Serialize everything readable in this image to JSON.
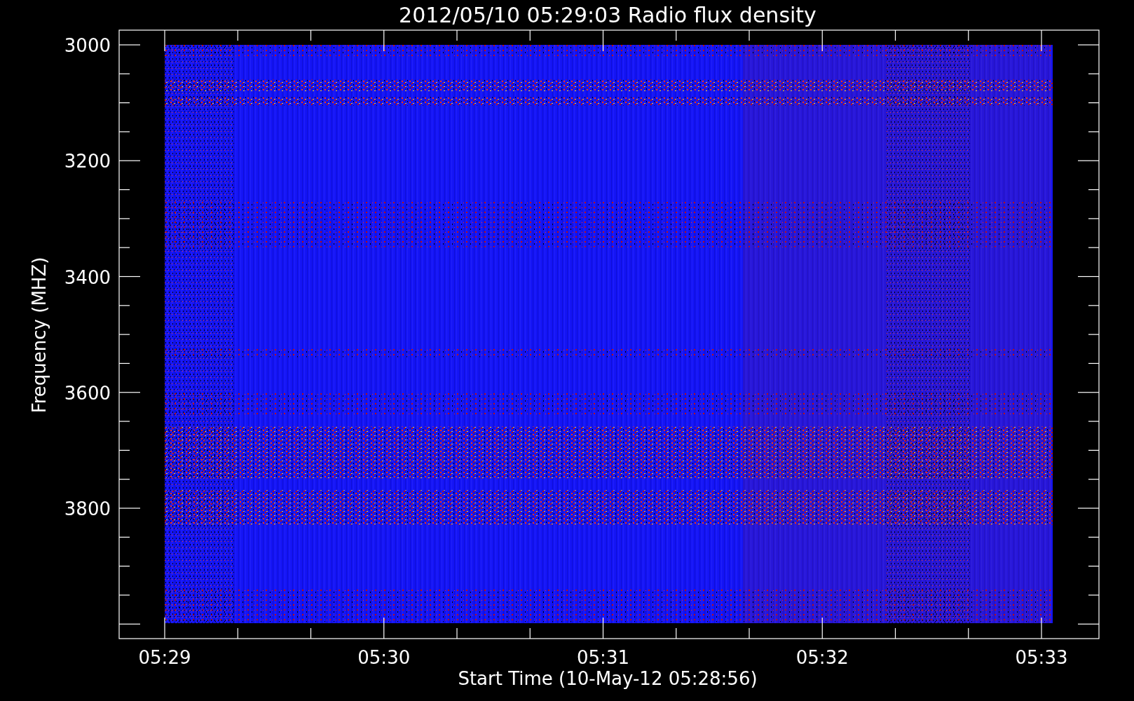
{
  "plot": {
    "title": "2012/05/10 05:29:03 Radio flux density",
    "ylabel": "Frequency (MHZ)",
    "xlabel": "Start Time (10-May-12 05:28:56)",
    "y_tick_labels": [
      "3000",
      "3200",
      "3400",
      "3600",
      "3800"
    ],
    "x_tick_labels": [
      "05:29",
      "05:30",
      "05:31",
      "05:32",
      "05:33"
    ]
  }
}
